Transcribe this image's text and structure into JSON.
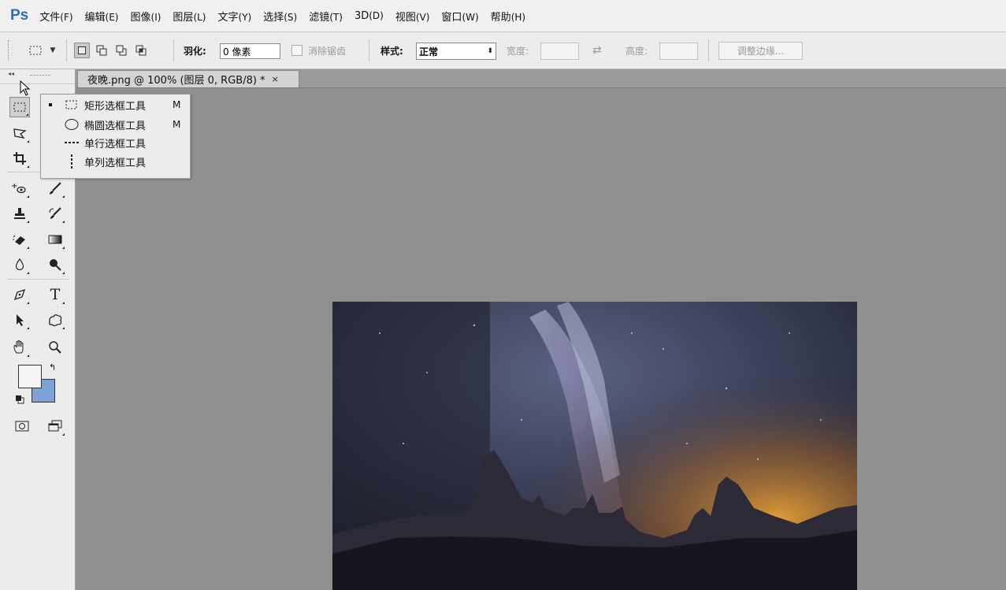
{
  "app": {
    "logo": "Ps"
  },
  "menu": [
    {
      "label": "文件",
      "accel": "(F)"
    },
    {
      "label": "编辑",
      "accel": "(E)"
    },
    {
      "label": "图像",
      "accel": "(I)"
    },
    {
      "label": "图层",
      "accel": "(L)"
    },
    {
      "label": "文字",
      "accel": "(Y)"
    },
    {
      "label": "选择",
      "accel": "(S)"
    },
    {
      "label": "滤镜",
      "accel": "(T)"
    },
    {
      "label": "3D",
      "accel": "(D)"
    },
    {
      "label": "视图",
      "accel": "(V)"
    },
    {
      "label": "窗口",
      "accel": "(W)"
    },
    {
      "label": "帮助",
      "accel": "(H)"
    }
  ],
  "options": {
    "feather_label": "羽化:",
    "feather_value": "0 像素",
    "antialias_label": "消除锯齿",
    "style_label": "样式:",
    "style_value": "正常",
    "width_label": "宽度:",
    "height_label": "高度:",
    "refine_edge_label": "调整边缘..."
  },
  "document": {
    "tab_title": "夜晚.png @ 100% (图层 0, RGB/8) *",
    "close_glyph": "×"
  },
  "flyout": {
    "items": [
      {
        "label": "矩形选框工具",
        "shortcut": "M",
        "selected": true,
        "icon": "rect-marquee-icon"
      },
      {
        "label": "椭圆选框工具",
        "shortcut": "M",
        "selected": false,
        "icon": "ellipse-marquee-icon"
      },
      {
        "label": "单行选框工具",
        "shortcut": "",
        "selected": false,
        "icon": "single-row-marquee-icon"
      },
      {
        "label": "单列选框工具",
        "shortcut": "",
        "selected": false,
        "icon": "single-column-marquee-icon"
      }
    ]
  },
  "colors": {
    "foreground": "#f4f4f4",
    "background": "#7ea2d6",
    "ps_brand": "#2d6fb6"
  }
}
